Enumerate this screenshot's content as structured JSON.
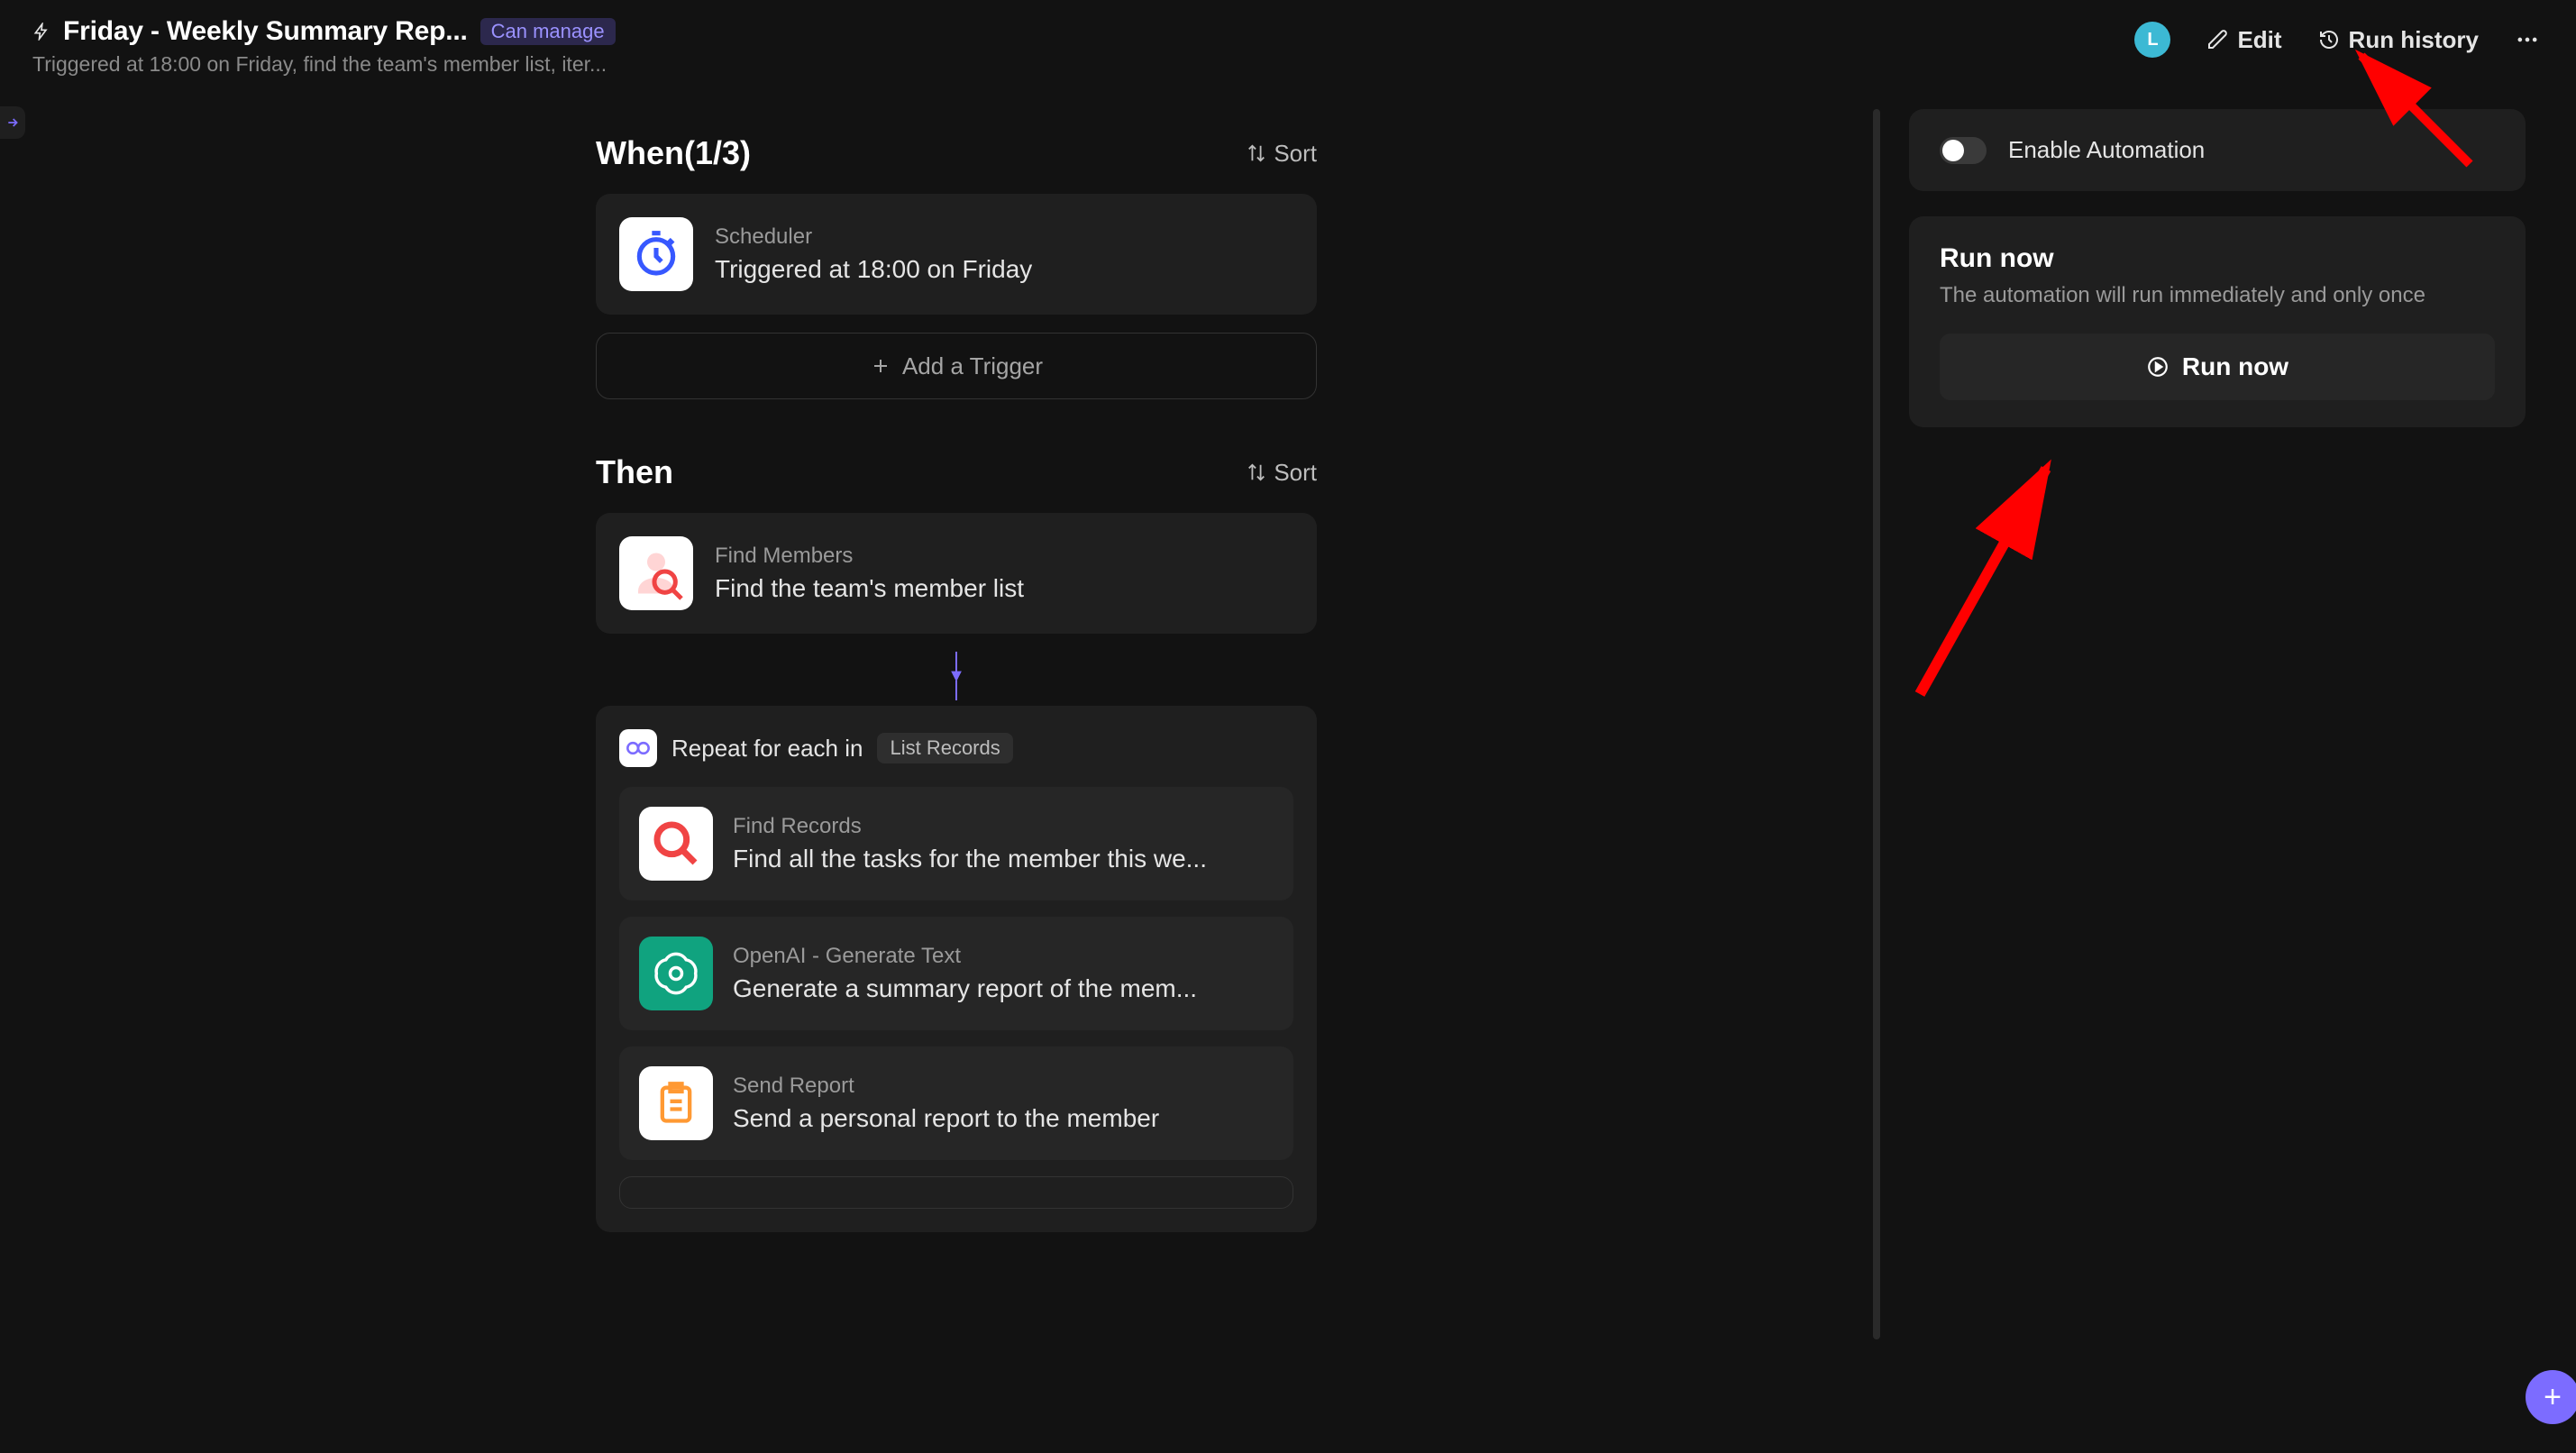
{
  "header": {
    "title": "Friday - Weekly Summary Rep...",
    "badge": "Can manage",
    "subtitle": "Triggered at 18:00 on Friday, find the team's member list, iter...",
    "avatar_letter": "L",
    "edit_label": "Edit",
    "run_history_label": "Run history"
  },
  "workflow": {
    "when_title": "When(1/3)",
    "then_title": "Then",
    "sort_label": "Sort",
    "add_trigger_label": "Add a Trigger",
    "trigger": {
      "label": "Scheduler",
      "desc": "Triggered at 18:00 on Friday"
    },
    "find_members": {
      "label": "Find Members",
      "desc": "Find the team's member list"
    },
    "loop": {
      "title": "Repeat for each in",
      "badge": "List Records",
      "steps": [
        {
          "label": "Find Records",
          "desc": "Find all the tasks for the member this we..."
        },
        {
          "label": "OpenAI - Generate Text",
          "desc": "Generate a summary report of the mem..."
        },
        {
          "label": "Send Report",
          "desc": "Send a personal report to the member"
        }
      ]
    }
  },
  "sidepanel": {
    "enable_label": "Enable Automation",
    "run_title": "Run now",
    "run_sub": "The automation will run immediately and only once",
    "run_btn": "Run now"
  }
}
